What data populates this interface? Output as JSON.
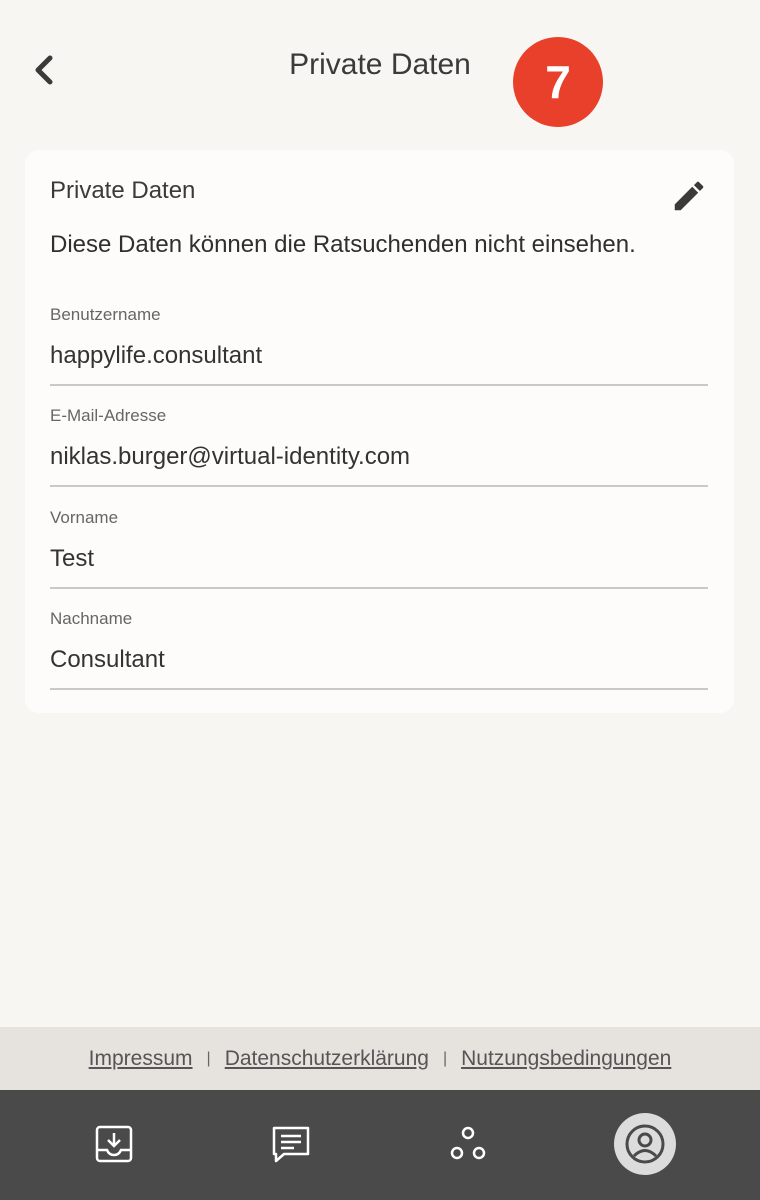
{
  "header": {
    "title": "Private Daten",
    "step_badge": "7",
    "back_icon": "chevron-left-icon"
  },
  "card": {
    "title": "Private Daten",
    "edit_icon": "pencil-icon",
    "description": "Diese Daten können die Ratsuchenden nicht einsehen.",
    "fields": [
      {
        "label": "Benutzername",
        "value": "happylife.consultant"
      },
      {
        "label": "E-Mail-Adresse",
        "value": "niklas.burger@virtual-identity.com"
      },
      {
        "label": "Vorname",
        "value": "Test"
      },
      {
        "label": "Nachname",
        "value": "Consultant"
      }
    ]
  },
  "footer": {
    "links": [
      "Impressum",
      "Datenschutzerklärung",
      "Nutzungsbedingungen"
    ],
    "separator": "|"
  },
  "nav": {
    "items": [
      {
        "icon": "inbox-download-icon"
      },
      {
        "icon": "chat-message-icon"
      },
      {
        "icon": "group-dots-icon"
      },
      {
        "icon": "profile-icon",
        "active": true
      }
    ]
  },
  "colors": {
    "accent": "#e8402a",
    "background": "#f7f6f3",
    "nav_bg": "#4a4a4a"
  }
}
